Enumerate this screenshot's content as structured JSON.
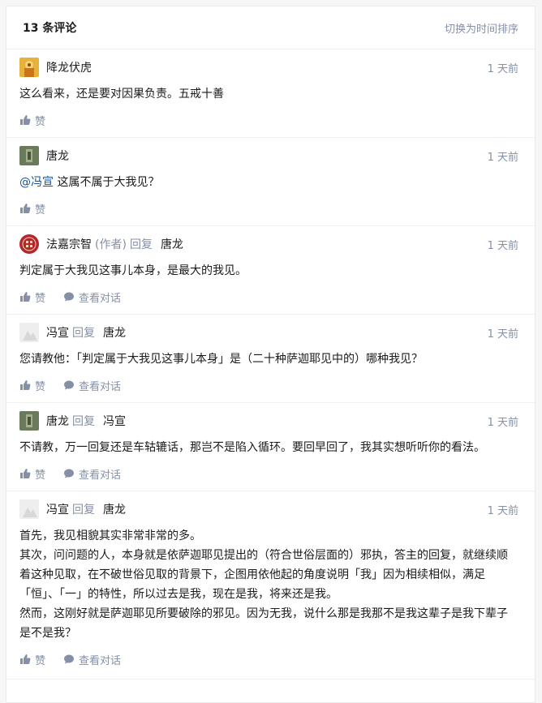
{
  "header": {
    "count_label": "13 条评论",
    "sort_toggle": "切换为时间排序"
  },
  "actions": {
    "like": "赞",
    "view_thread": "查看对话"
  },
  "comments": [
    {
      "author": "降龙伏虎",
      "time": "1 天前",
      "body": [
        "这么看来，还是要对因果负责。五戒十善"
      ]
    },
    {
      "author": "唐龙",
      "time": "1 天前",
      "mention": "@冯宣",
      "body": [
        " 这属不属于大我见？"
      ]
    },
    {
      "author": "法嘉宗智",
      "author_tag": "(作者)",
      "reply_word": "回复",
      "reply_to": "唐龙",
      "time": "1 天前",
      "body": [
        "判定属于大我见这事儿本身，是最大的我见。"
      ]
    },
    {
      "author": "冯宣",
      "reply_word": "回复",
      "reply_to": "唐龙",
      "time": "1 天前",
      "body": [
        "您请教他：「判定属于大我见这事儿本身」是（二十种萨迦耶见中的）哪种我见？"
      ]
    },
    {
      "author": "唐龙",
      "reply_word": "回复",
      "reply_to": "冯宣",
      "time": "1 天前",
      "body": [
        "不请教，万一回复还是车轱辘话，那岂不是陷入循环。要回早回了，我其实想听听你的看法。"
      ]
    },
    {
      "author": "冯宣",
      "reply_word": "回复",
      "reply_to": "唐龙",
      "time": "1 天前",
      "body": [
        "首先，我见相貌其实非常非常的多。",
        "其次，问问题的人，本身就是依萨迦耶见提出的（符合世俗层面的）邪执，答主的回复，就继续顺着这种见取，在不破世俗见取的背景下，企图用依他起的角度说明「我」因为相续相似，满足「恒」、「一」的特性，所以过去是我，现在是我，将来还是我。",
        "然而，这刚好就是萨迦耶见所要破除的邪见。因为无我，说什么那是我那不是我这辈子是我下辈子是不是我？"
      ]
    }
  ]
}
